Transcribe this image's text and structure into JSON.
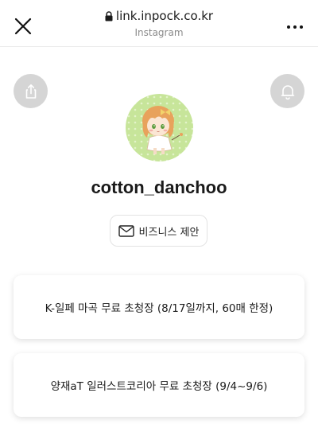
{
  "browser": {
    "url": "link.inpock.co.kr",
    "source": "Instagram",
    "close_icon": "close-icon",
    "lock_icon": "lock-icon",
    "more_icon": "more-dots-icon"
  },
  "profile": {
    "username": "cotton_danchoo",
    "share_icon": "share-icon",
    "bell_icon": "bell-icon",
    "avatar_bg": "#c7e59a"
  },
  "business_button": {
    "label": "비즈니스 제안",
    "icon": "mail-icon"
  },
  "links": [
    {
      "label": "K-일페 마곡 무료 초청장 (8/17일까지, 60매 한정)"
    },
    {
      "label": "양재aT 일러스트코리아 무료 초청장 (9/4~9/6)"
    }
  ]
}
